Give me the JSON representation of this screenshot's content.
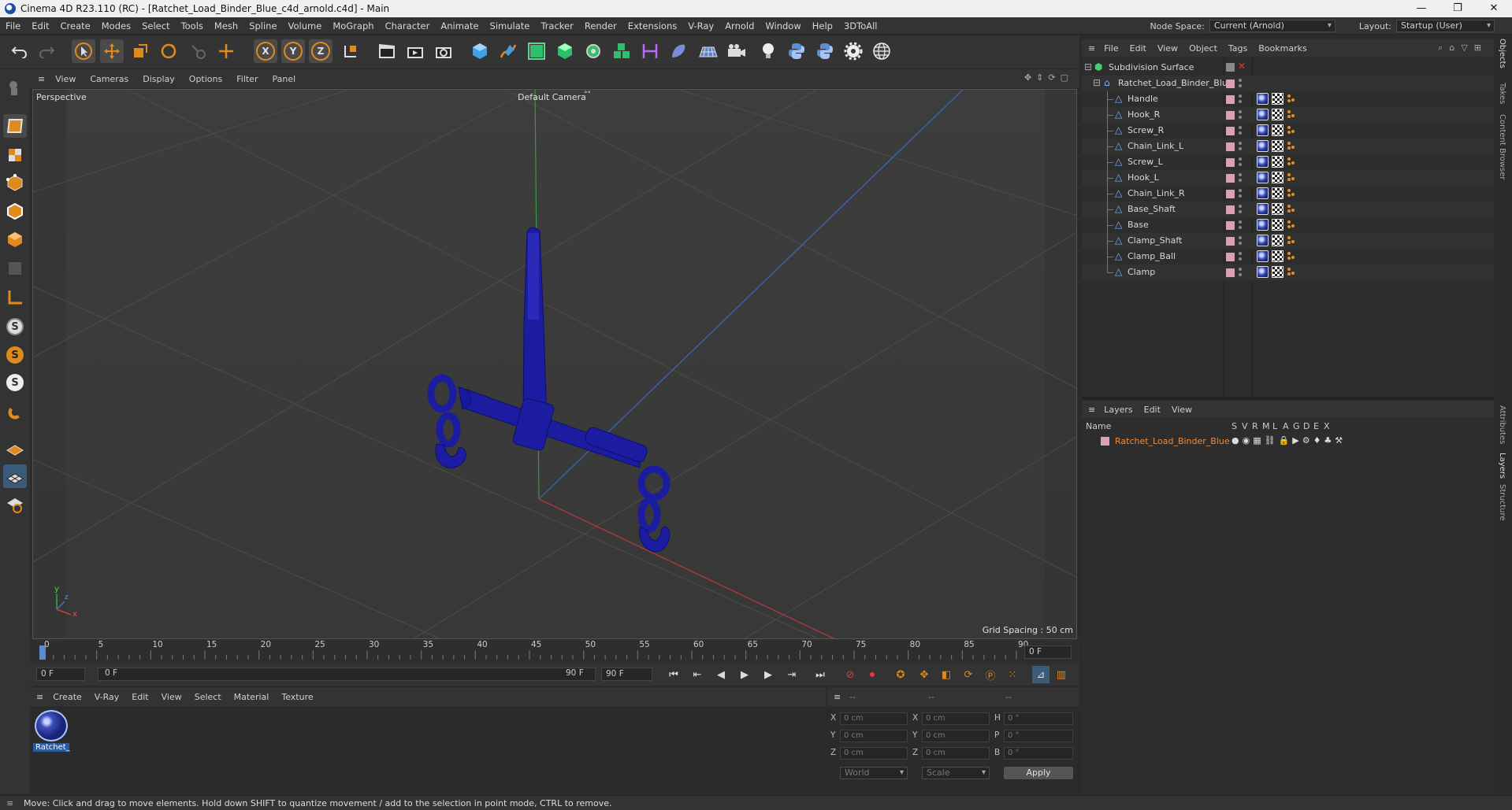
{
  "window": {
    "title": "Cinema 4D R23.110 (RC) - [Ratchet_Load_Binder_Blue_c4d_arnold.c4d] - Main",
    "min": "—",
    "max": "❐",
    "close": "✕"
  },
  "menubar": {
    "items": [
      "File",
      "Edit",
      "Create",
      "Modes",
      "Select",
      "Tools",
      "Mesh",
      "Spline",
      "Volume",
      "MoGraph",
      "Character",
      "Animate",
      "Simulate",
      "Tracker",
      "Render",
      "Extensions",
      "V-Ray",
      "Arnold",
      "Window",
      "Help",
      "3DToAll"
    ],
    "node_space_label": "Node Space:",
    "node_space_value": "Current (Arnold)",
    "layout_label": "Layout:",
    "layout_value": "Startup (User)"
  },
  "toolbar": {
    "axis_x": "X",
    "axis_y": "Y",
    "axis_z": "Z"
  },
  "lefttools": {
    "s1": "S",
    "s2": "S",
    "s3": "S"
  },
  "viewport": {
    "menu": [
      "View",
      "Cameras",
      "Display",
      "Options",
      "Filter",
      "Panel"
    ],
    "projection": "Perspective",
    "camera": "Default Camera",
    "camera_suffix": "°°",
    "grid_spacing": "Grid Spacing : 50 cm",
    "axis_y": "y",
    "axis_x": "x",
    "axis_z": "z"
  },
  "timeline": {
    "ticks": [
      "0",
      "5",
      "10",
      "15",
      "20",
      "25",
      "30",
      "35",
      "40",
      "45",
      "50",
      "55",
      "60",
      "65",
      "70",
      "75",
      "80",
      "85",
      "90"
    ],
    "current_frame": "0 F",
    "start_field": "0 F",
    "range_start": "0 F",
    "range_end": "90 F",
    "end_field": "90 F",
    "current_field": "0 F"
  },
  "material_manager": {
    "menu": [
      "Create",
      "V-Ray",
      "Edit",
      "View",
      "Select",
      "Material",
      "Texture"
    ],
    "material_name": "Ratchet_"
  },
  "coord_manager": {
    "header": [
      "--",
      "--",
      "--"
    ],
    "rows": [
      {
        "l1": "X",
        "v1": "0 cm",
        "l2": "X",
        "v2": "0 cm",
        "l3": "H",
        "v3": "0 °"
      },
      {
        "l1": "Y",
        "v1": "0 cm",
        "l2": "Y",
        "v2": "0 cm",
        "l3": "P",
        "v3": "0 °"
      },
      {
        "l1": "Z",
        "v1": "0 cm",
        "l2": "Z",
        "v2": "0 cm",
        "l3": "B",
        "v3": "0 °"
      }
    ],
    "space": "World",
    "mode": "Scale",
    "apply": "Apply"
  },
  "object_manager": {
    "menu": [
      "File",
      "Edit",
      "View",
      "Object",
      "Tags",
      "Bookmarks"
    ],
    "root": "Subdivision Surface",
    "group": "Ratchet_Load_Binder_Blue",
    "objects": [
      "Handle",
      "Hook_R",
      "Screw_R",
      "Chain_Link_L",
      "Screw_L",
      "Hook_L",
      "Chain_Link_R",
      "Base_Shaft",
      "Base",
      "Clamp_Shaft",
      "Clamp_Ball",
      "Clamp"
    ]
  },
  "layer_manager": {
    "menu": [
      "Layers",
      "Edit",
      "View"
    ],
    "col_name": "Name",
    "flags": [
      "S",
      "V",
      "R",
      "M",
      "L",
      "A",
      "G",
      "D",
      "E",
      "X"
    ],
    "layer_name": "Ratchet_Load_Binder_Blue"
  },
  "right_tabs": [
    "Objects",
    "Takes",
    "Content Browser",
    "Attributes",
    "Layers",
    "Structure"
  ],
  "status": "Move: Click and drag to move elements. Hold down SHIFT to quantize movement / add to the selection in point mode, CTRL to remove.",
  "colors": {
    "accent": "#e08a1e",
    "model": "#1c1ca0",
    "layer_text": "#f08a3a"
  }
}
